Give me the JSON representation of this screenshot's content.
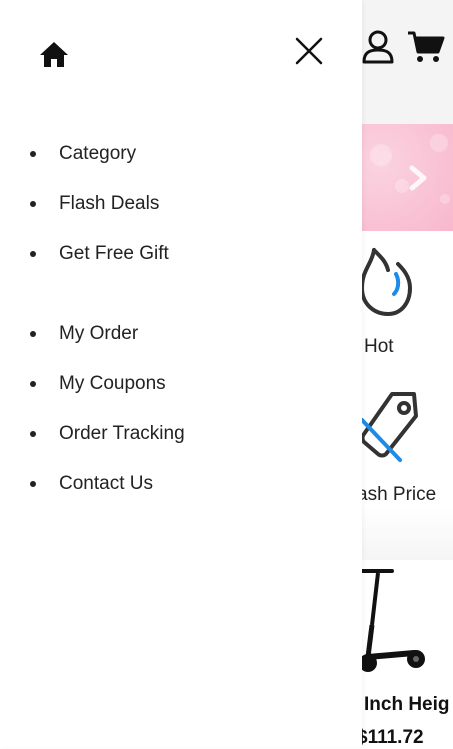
{
  "drawer": {
    "menu_primary": [
      {
        "label": "Category"
      },
      {
        "label": "Flash Deals"
      },
      {
        "label": "Get Free Gift"
      }
    ],
    "menu_secondary": [
      {
        "label": "My Order"
      },
      {
        "label": "My Coupons"
      },
      {
        "label": "Order Tracking"
      },
      {
        "label": "Contact Us"
      }
    ],
    "icons": {
      "home": "home-icon",
      "close": "close-icon"
    }
  },
  "background": {
    "icons": {
      "user": "user-icon",
      "cart": "cart-icon",
      "next": "chevron-right-icon",
      "hot": "hot-icon",
      "flash": "tag-icon"
    },
    "category_hot_label": "Hot",
    "category_flash_label": "ash Price",
    "product_name": "Inch Heig",
    "product_price": "$111.72"
  },
  "colors": {
    "accent_blue": "#1e8be6",
    "banner_pink": "#f49dbb",
    "text": "#222222"
  }
}
